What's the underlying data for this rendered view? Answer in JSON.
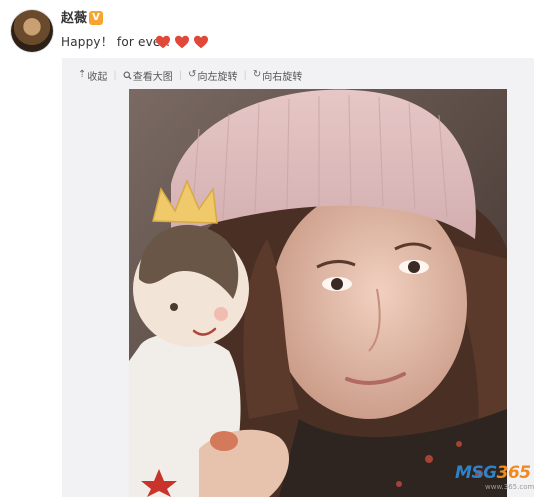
{
  "post": {
    "username": "赵薇",
    "verified_mark": "V",
    "text": "Happy！ for ever!",
    "emoji_icons": [
      "red-heart-icon",
      "red-heart-icon",
      "red-heart-icon"
    ]
  },
  "toolbar": {
    "collapse": {
      "icon": "collapse-up-icon",
      "label": "收起"
    },
    "view_large": {
      "icon": "magnifier-icon",
      "label": "查看大图"
    },
    "rotate_left": {
      "icon": "rotate-left-icon",
      "label": "向左旋转"
    },
    "rotate_right": {
      "icon": "rotate-right-icon",
      "label": "向右旋转"
    }
  },
  "watermark": {
    "logo": "MSG365",
    "site": "www.365.com"
  },
  "colors": {
    "heart": "#e0493a",
    "badge": "#f7a531",
    "card_bg": "#f2f2f5",
    "watermark_blue": "#2d82c8",
    "watermark_orange": "#f08a1f"
  }
}
